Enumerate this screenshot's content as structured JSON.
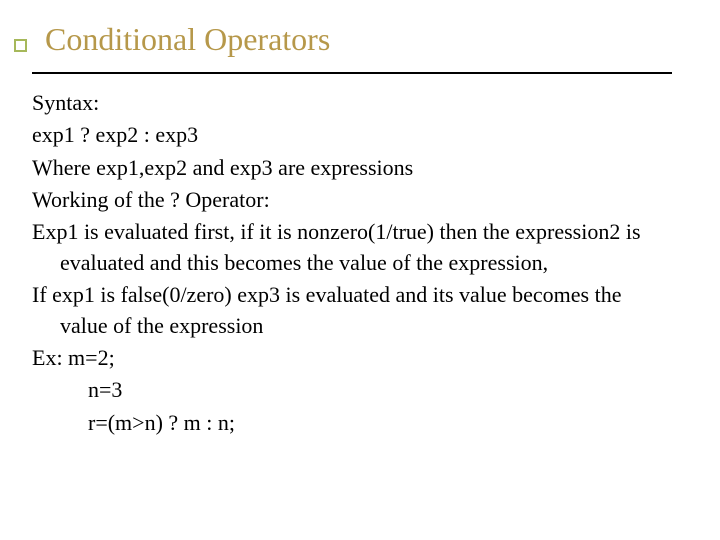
{
  "title": "Conditional Operators",
  "body": {
    "p1": "Syntax:",
    "p2": "exp1 ? exp2 : exp3",
    "p3": "Where exp1,exp2 and exp3 are expressions",
    "p4": "Working of the ? Operator:",
    "p5": "Exp1 is evaluated first, if it is nonzero(1/true) then the expression2 is evaluated and this becomes the value of the expression,",
    "p6": "If exp1 is false(0/zero) exp3 is evaluated and its value becomes  the value of the expression",
    "p7": "Ex: m=2;",
    "p8": "n=3",
    "p9": "r=(m>n) ? m : n;"
  }
}
